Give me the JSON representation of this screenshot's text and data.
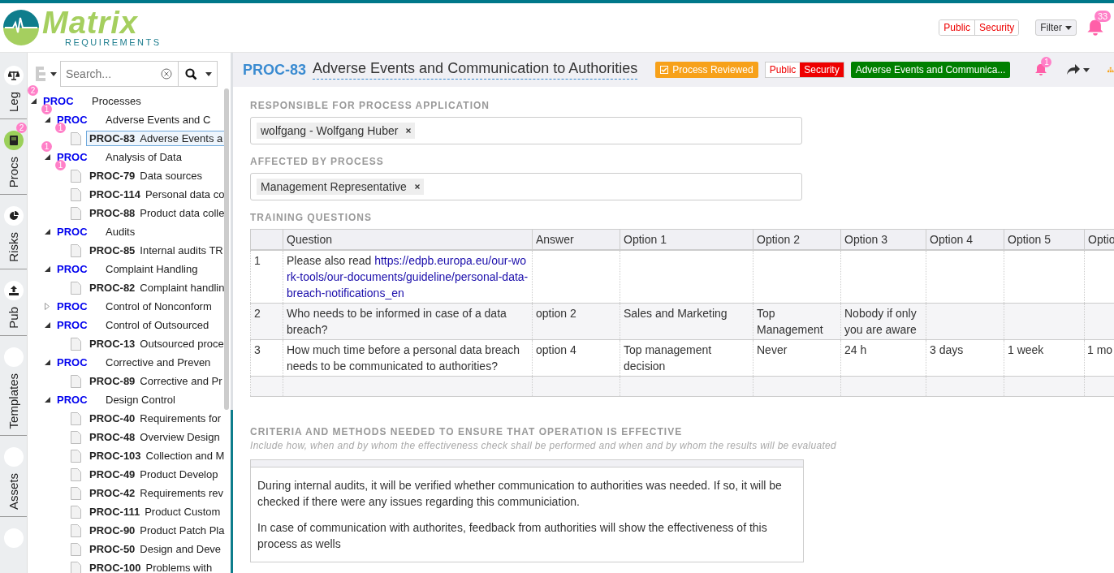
{
  "header": {
    "logo": {
      "name": "Matrix",
      "tagline": "REQUIREMENTS"
    },
    "labels": [
      "Public",
      "Security"
    ],
    "filter": "Filter",
    "notifications": "33"
  },
  "side_tabs": [
    {
      "label": "Leg",
      "selected": false
    },
    {
      "label": "Procs",
      "selected": true,
      "badge": "2"
    },
    {
      "label": "Risks",
      "selected": false
    },
    {
      "label": "Pub",
      "selected": false
    },
    {
      "label": "Templates",
      "selected": false
    },
    {
      "label": "Assets",
      "selected": false
    }
  ],
  "tree": {
    "search": {
      "placeholder": "Search..."
    },
    "items": [
      {
        "kind": "folder",
        "id": "PROC",
        "title": "Processes",
        "expanded": true,
        "badge": "2",
        "children": [
          {
            "kind": "folder",
            "id": "PROC",
            "title": "Adverse Events and C",
            "expanded": true,
            "badge": "1",
            "children": [
              {
                "kind": "item",
                "id": "PROC-83",
                "title": "Adverse Events a",
                "selected": true,
                "badge": "1"
              }
            ]
          },
          {
            "kind": "folder",
            "id": "PROC",
            "title": "Analysis of Data",
            "expanded": true,
            "badge": "1",
            "children": [
              {
                "kind": "item",
                "id": "PROC-79",
                "title": "Data sources",
                "selected": false,
                "badge": "1"
              },
              {
                "kind": "item",
                "id": "PROC-114",
                "title": "Personal data co",
                "selected": false
              },
              {
                "kind": "item",
                "id": "PROC-88",
                "title": "Product data colle",
                "selected": false
              }
            ]
          },
          {
            "kind": "folder",
            "id": "PROC",
            "title": "Audits",
            "expanded": true,
            "children": [
              {
                "kind": "item",
                "id": "PROC-85",
                "title": "Internal audits TR",
                "selected": false
              }
            ]
          },
          {
            "kind": "folder",
            "id": "PROC",
            "title": "Complaint Handling",
            "expanded": true,
            "children": [
              {
                "kind": "item",
                "id": "PROC-82",
                "title": "Complaint handlin",
                "selected": false
              }
            ]
          },
          {
            "kind": "folder",
            "id": "PROC",
            "title": "Control of Nonconform",
            "expanded": false
          },
          {
            "kind": "folder",
            "id": "PROC",
            "title": "Control of Outsourced",
            "expanded": true,
            "children": [
              {
                "kind": "item",
                "id": "PROC-13",
                "title": "Outsourced proce",
                "selected": false
              }
            ]
          },
          {
            "kind": "folder",
            "id": "PROC",
            "title": "Corrective and Preven",
            "expanded": true,
            "children": [
              {
                "kind": "item",
                "id": "PROC-89",
                "title": "Corrective and Pr",
                "selected": false
              }
            ]
          },
          {
            "kind": "folder",
            "id": "PROC",
            "title": "Design Control",
            "expanded": true,
            "children": [
              {
                "kind": "item",
                "id": "PROC-40",
                "title": "Requirements for",
                "selected": false
              },
              {
                "kind": "item",
                "id": "PROC-48",
                "title": "Overview Design",
                "selected": false
              },
              {
                "kind": "item",
                "id": "PROC-103",
                "title": "Collection and M",
                "selected": false
              },
              {
                "kind": "item",
                "id": "PROC-49",
                "title": "Product Develop",
                "selected": false
              },
              {
                "kind": "item",
                "id": "PROC-42",
                "title": "Requirements rev",
                "selected": false
              },
              {
                "kind": "item",
                "id": "PROC-111",
                "title": "Product Custom",
                "selected": false
              },
              {
                "kind": "item",
                "id": "PROC-90",
                "title": "Product Patch Pla",
                "selected": false
              },
              {
                "kind": "item",
                "id": "PROC-50",
                "title": "Design and Deve",
                "selected": false
              },
              {
                "kind": "item",
                "id": "PROC-100",
                "title": "Problems with",
                "selected": false
              }
            ]
          }
        ]
      }
    ]
  },
  "document": {
    "id": "PROC-83",
    "title": "Adverse Events and Communication to Authorities",
    "tags": [
      {
        "kind": "check",
        "label": "Process Reviewed",
        "checked": true,
        "color": "#f7a11a"
      },
      {
        "kind": "group",
        "labels": [
          "Public",
          "Security"
        ]
      },
      {
        "kind": "plain",
        "label": "Adverse Events and Communica...",
        "color": "#008000"
      }
    ],
    "notifications": "1",
    "sections": [
      {
        "kind": "tags",
        "heading": "RESPONSIBLE FOR PROCESS APPLICATION",
        "values": [
          "wolfgang - Wolfgang Huber"
        ]
      },
      {
        "kind": "tags",
        "heading": "AFFECTED BY PROCESS",
        "values": [
          "Management Representative"
        ]
      },
      {
        "kind": "table",
        "heading": "TRAINING QUESTIONS",
        "columns": [
          "",
          "Question",
          "Answer",
          "Option 1",
          "Option 2",
          "Option 3",
          "Option 4",
          "Option 5",
          "Optio"
        ],
        "rows": [
          {
            "cells": [
              "1",
              "Please also read",
              "",
              "",
              "",
              "",
              "",
              "",
              ""
            ],
            "link": "https://edpb.europa.eu/our-work-tools/our-documents/guideline/personal-data-breach-notifications_en"
          },
          {
            "cells": [
              "2",
              "Who needs to be informed in case of a data breach?",
              "option 2",
              "Sales and Marketing",
              "Top Management",
              "Nobody if only you are aware",
              "",
              "",
              ""
            ]
          },
          {
            "cells": [
              "3",
              "How much time before a personal data breach needs to be communicated to authorities?",
              "option 4",
              "Top management decision",
              "Never",
              "24 h",
              "3 days",
              "1 week",
              "1 mo"
            ]
          },
          {
            "cells": [
              "",
              "",
              "",
              "",
              "",
              "",
              "",
              "",
              ""
            ]
          }
        ]
      },
      {
        "kind": "text",
        "heading": "CRITERIA AND METHODS NEEDED TO ENSURE THAT OPERATION IS EFFECTIVE",
        "hint": "Include how, when and by whom the effectiveness check shall be performed and when and by whom the results will be evaluated",
        "paragraphs": [
          "During internal audits, it will be verified whether communication to authorities was needed. If so, it will be checked if there were any issues regarding this communiciation.",
          "In case of communication with authorites, feedback from authorities will show the effectiveness of this process as wells"
        ]
      }
    ]
  }
}
